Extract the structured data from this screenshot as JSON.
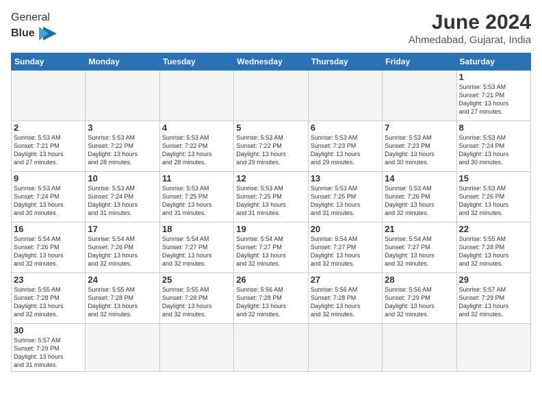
{
  "header": {
    "logo_general": "General",
    "logo_blue": "Blue",
    "month_title": "June 2024",
    "location": "Ahmedabad, Gujarat, India"
  },
  "weekdays": [
    "Sunday",
    "Monday",
    "Tuesday",
    "Wednesday",
    "Thursday",
    "Friday",
    "Saturday"
  ],
  "weeks": [
    [
      {
        "day": "",
        "info": ""
      },
      {
        "day": "",
        "info": ""
      },
      {
        "day": "",
        "info": ""
      },
      {
        "day": "",
        "info": ""
      },
      {
        "day": "",
        "info": ""
      },
      {
        "day": "",
        "info": ""
      },
      {
        "day": "1",
        "info": "Sunrise: 5:53 AM\nSunset: 7:21 PM\nDaylight: 13 hours\nand 27 minutes."
      }
    ],
    [
      {
        "day": "2",
        "info": "Sunrise: 5:53 AM\nSunset: 7:21 PM\nDaylight: 13 hours\nand 27 minutes."
      },
      {
        "day": "3",
        "info": "Sunrise: 5:53 AM\nSunset: 7:22 PM\nDaylight: 13 hours\nand 28 minutes."
      },
      {
        "day": "4",
        "info": "Sunrise: 5:53 AM\nSunset: 7:22 PM\nDaylight: 13 hours\nand 28 minutes."
      },
      {
        "day": "5",
        "info": "Sunrise: 5:53 AM\nSunset: 7:22 PM\nDaylight: 13 hours\nand 29 minutes."
      },
      {
        "day": "6",
        "info": "Sunrise: 5:53 AM\nSunset: 7:23 PM\nDaylight: 13 hours\nand 29 minutes."
      },
      {
        "day": "7",
        "info": "Sunrise: 5:53 AM\nSunset: 7:23 PM\nDaylight: 13 hours\nand 30 minutes."
      },
      {
        "day": "8",
        "info": "Sunrise: 5:53 AM\nSunset: 7:24 PM\nDaylight: 13 hours\nand 30 minutes."
      }
    ],
    [
      {
        "day": "9",
        "info": "Sunrise: 5:53 AM\nSunset: 7:24 PM\nDaylight: 13 hours\nand 30 minutes."
      },
      {
        "day": "10",
        "info": "Sunrise: 5:53 AM\nSunset: 7:24 PM\nDaylight: 13 hours\nand 31 minutes."
      },
      {
        "day": "11",
        "info": "Sunrise: 5:53 AM\nSunset: 7:25 PM\nDaylight: 13 hours\nand 31 minutes."
      },
      {
        "day": "12",
        "info": "Sunrise: 5:53 AM\nSunset: 7:25 PM\nDaylight: 13 hours\nand 31 minutes."
      },
      {
        "day": "13",
        "info": "Sunrise: 5:53 AM\nSunset: 7:25 PM\nDaylight: 13 hours\nand 31 minutes."
      },
      {
        "day": "14",
        "info": "Sunrise: 5:53 AM\nSunset: 7:26 PM\nDaylight: 13 hours\nand 32 minutes."
      },
      {
        "day": "15",
        "info": "Sunrise: 5:53 AM\nSunset: 7:26 PM\nDaylight: 13 hours\nand 32 minutes."
      }
    ],
    [
      {
        "day": "16",
        "info": "Sunrise: 5:54 AM\nSunset: 7:26 PM\nDaylight: 13 hours\nand 32 minutes."
      },
      {
        "day": "17",
        "info": "Sunrise: 5:54 AM\nSunset: 7:26 PM\nDaylight: 13 hours\nand 32 minutes."
      },
      {
        "day": "18",
        "info": "Sunrise: 5:54 AM\nSunset: 7:27 PM\nDaylight: 13 hours\nand 32 minutes."
      },
      {
        "day": "19",
        "info": "Sunrise: 5:54 AM\nSunset: 7:27 PM\nDaylight: 13 hours\nand 32 minutes."
      },
      {
        "day": "20",
        "info": "Sunrise: 5:54 AM\nSunset: 7:27 PM\nDaylight: 13 hours\nand 32 minutes."
      },
      {
        "day": "21",
        "info": "Sunrise: 5:54 AM\nSunset: 7:27 PM\nDaylight: 13 hours\nand 32 minutes."
      },
      {
        "day": "22",
        "info": "Sunrise: 5:55 AM\nSunset: 7:28 PM\nDaylight: 13 hours\nand 32 minutes."
      }
    ],
    [
      {
        "day": "23",
        "info": "Sunrise: 5:55 AM\nSunset: 7:28 PM\nDaylight: 13 hours\nand 32 minutes."
      },
      {
        "day": "24",
        "info": "Sunrise: 5:55 AM\nSunset: 7:28 PM\nDaylight: 13 hours\nand 32 minutes."
      },
      {
        "day": "25",
        "info": "Sunrise: 5:55 AM\nSunset: 7:28 PM\nDaylight: 13 hours\nand 32 minutes."
      },
      {
        "day": "26",
        "info": "Sunrise: 5:56 AM\nSunset: 7:28 PM\nDaylight: 13 hours\nand 32 minutes."
      },
      {
        "day": "27",
        "info": "Sunrise: 5:56 AM\nSunset: 7:28 PM\nDaylight: 13 hours\nand 32 minutes."
      },
      {
        "day": "28",
        "info": "Sunrise: 5:56 AM\nSunset: 7:29 PM\nDaylight: 13 hours\nand 32 minutes."
      },
      {
        "day": "29",
        "info": "Sunrise: 5:57 AM\nSunset: 7:29 PM\nDaylight: 13 hours\nand 32 minutes."
      }
    ],
    [
      {
        "day": "30",
        "info": "Sunrise: 5:57 AM\nSunset: 7:29 PM\nDaylight: 13 hours\nand 31 minutes."
      },
      {
        "day": "",
        "info": ""
      },
      {
        "day": "",
        "info": ""
      },
      {
        "day": "",
        "info": ""
      },
      {
        "day": "",
        "info": ""
      },
      {
        "day": "",
        "info": ""
      },
      {
        "day": "",
        "info": ""
      }
    ]
  ]
}
